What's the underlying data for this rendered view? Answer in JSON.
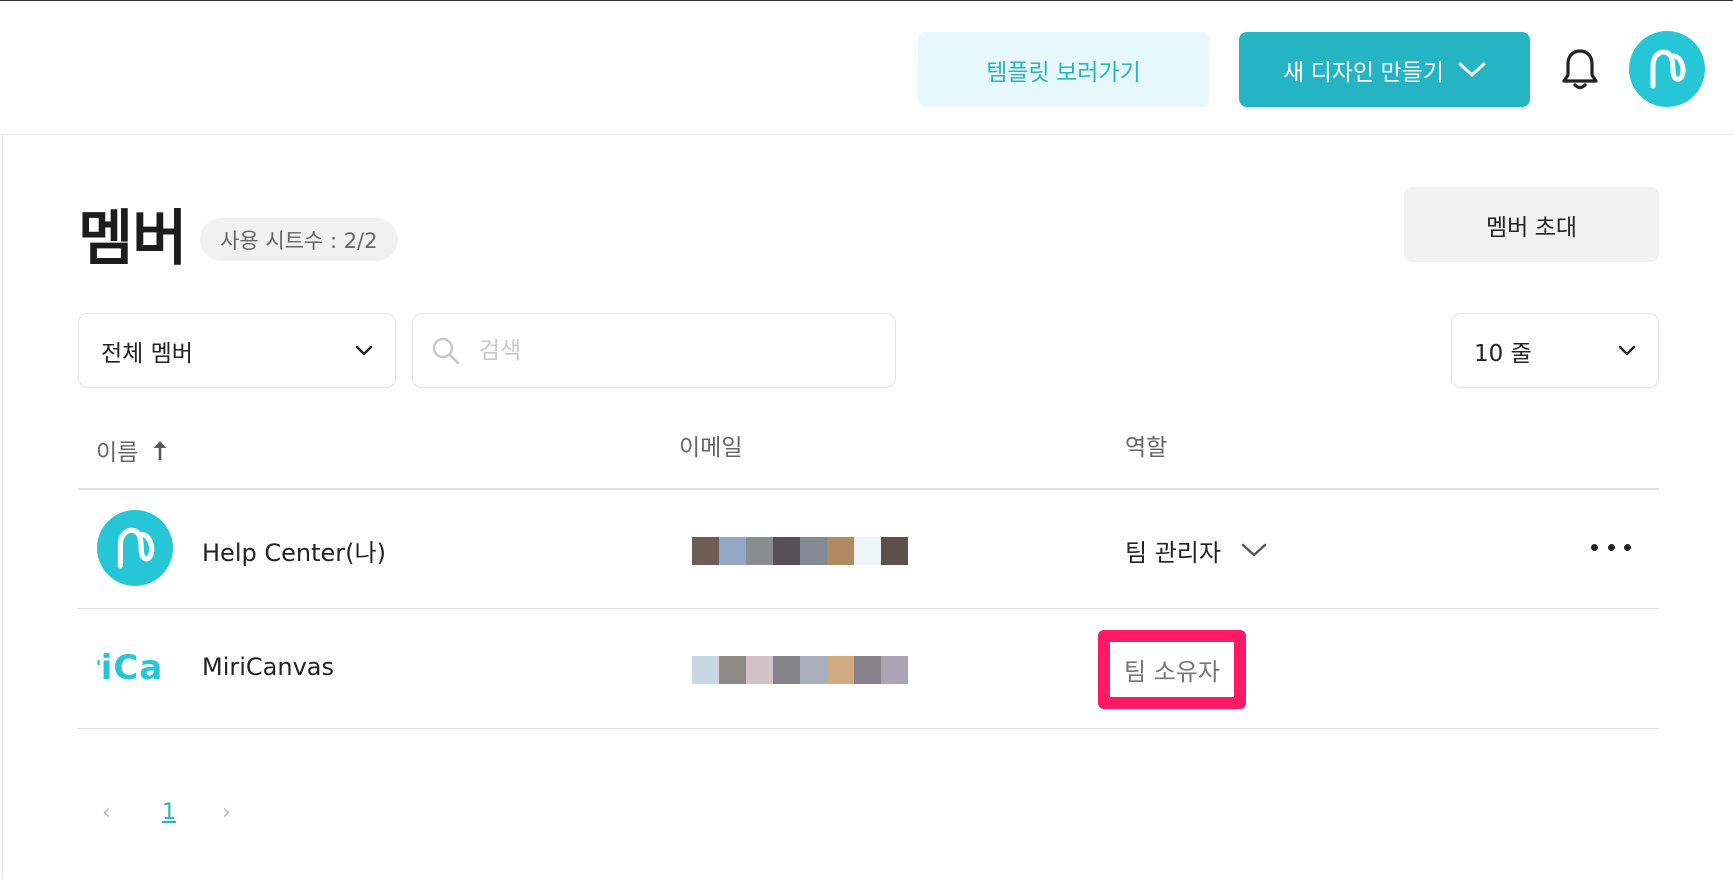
{
  "header": {
    "template_button": "템플릿 보러가기",
    "new_design_button": "새 디자인 만들기",
    "notification_icon": "bell-icon",
    "avatar_icon": "miricanvas-logo-icon"
  },
  "page": {
    "title": "멤버",
    "seat_badge": "사용 시트수 : 2/2",
    "invite_button": "멤버 초대"
  },
  "filters": {
    "member_filter": "전체 멤버",
    "search_placeholder": "검색",
    "rows_per_page": "10 줄"
  },
  "table": {
    "columns": {
      "name": "이름",
      "email": "이메일",
      "role": "역할"
    },
    "rows": [
      {
        "name": "Help Center(나)",
        "role": "팀 관리자",
        "role_editable": true
      },
      {
        "name": "MiriCanvas",
        "avatar_text": "riCa",
        "role": "팀 소유자",
        "role_editable": false
      }
    ]
  },
  "pagination": {
    "prev": "‹",
    "current": "1",
    "next": "›"
  },
  "colors": {
    "accent": "#24b4c4",
    "accent_light": "#e6f8fb",
    "highlight": "#ff1a66"
  }
}
